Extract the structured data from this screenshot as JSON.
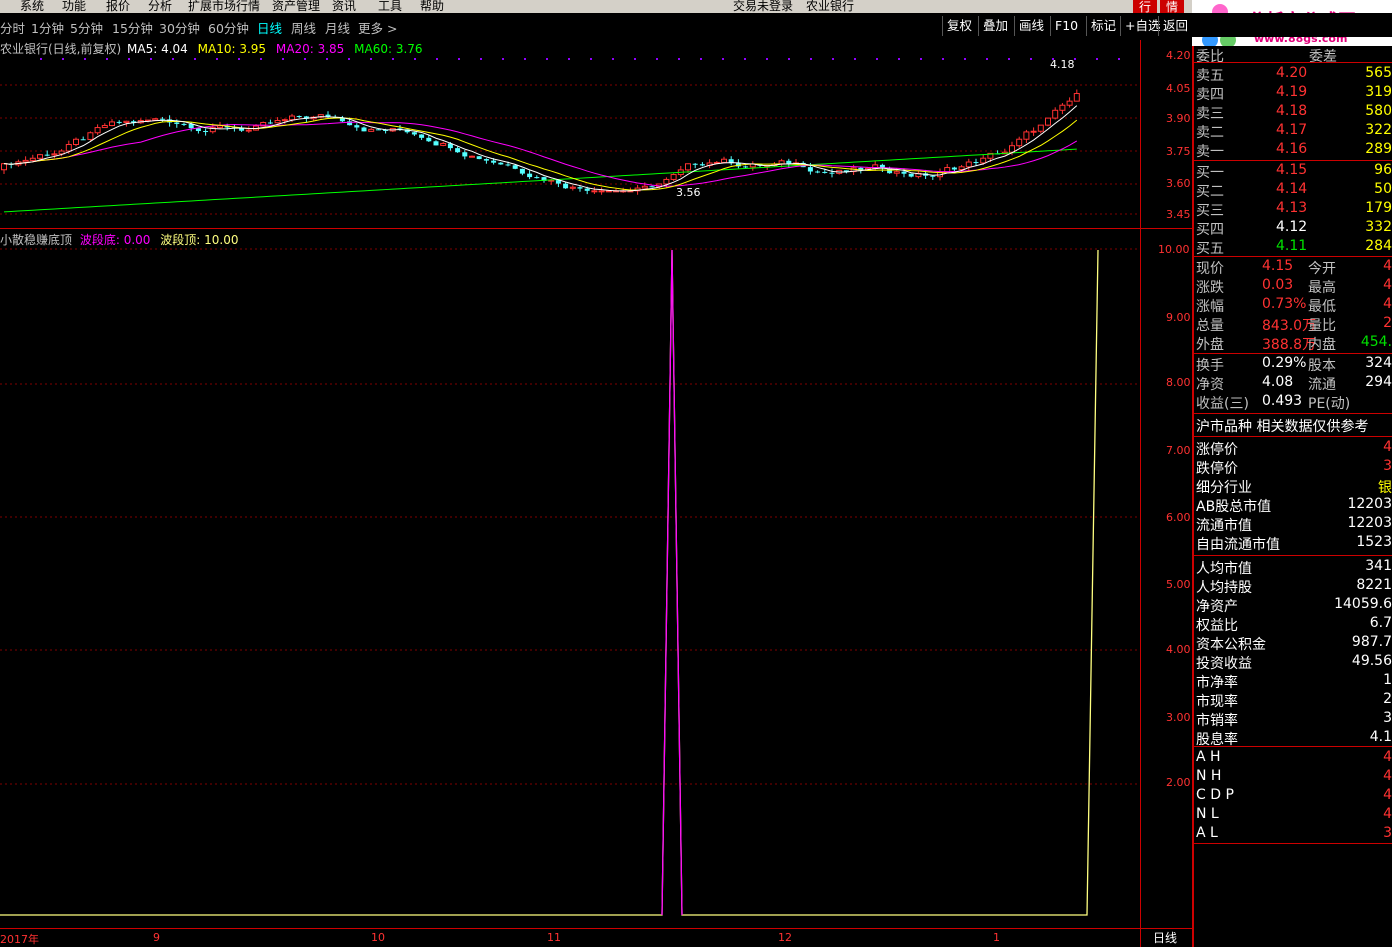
{
  "menubar": {
    "items": [
      "系统",
      "功能",
      "报价",
      "分析",
      "扩展市场行情",
      "资产管理",
      "资讯",
      "工具",
      "帮助"
    ],
    "center_status": "交易未登录",
    "stock_name": "农业银行",
    "tabs": [
      "行",
      "情"
    ]
  },
  "logo": {
    "main_text": "分析家公式网",
    "sub_text": "www.88gs.com"
  },
  "toolbar": {
    "periods": [
      "分时",
      "1分钟",
      "5分钟",
      "15分钟",
      "30分钟",
      "60分钟",
      "日线",
      "周线",
      "月线",
      "更多 >"
    ],
    "active_period": "日线",
    "buttons": [
      "复权",
      "叠加",
      "画线",
      "F10",
      "标记",
      "+自选",
      "返回"
    ]
  },
  "main_chart": {
    "title": "农业银行(日线,前复权)",
    "ma": [
      {
        "label": "MA5: 4.04",
        "color": "#ffffff"
      },
      {
        "label": "MA10: 3.95",
        "color": "#ffff00"
      },
      {
        "label": "MA20: 3.85",
        "color": "#ff00ff"
      },
      {
        "label": "MA60: 3.76",
        "color": "#00ff00"
      }
    ],
    "y_ticks": [
      "4.20",
      "4.05",
      "3.90",
      "3.75",
      "3.60",
      "3.45"
    ],
    "high_label": "4.18",
    "low_label": "3.56"
  },
  "indicator": {
    "name": "小散稳赚底顶",
    "low_label": "波段底: 0.00",
    "high_label": "波段顶: 10.00",
    "low_color": "#ff00ff",
    "high_color": "#ffff00",
    "y_ticks": [
      "10.00",
      "9.00",
      "8.00",
      "7.00",
      "6.00",
      "5.00",
      "4.00",
      "3.00",
      "2.00"
    ]
  },
  "x_axis": {
    "labels": [
      "2017年",
      "9",
      "10",
      "11",
      "12",
      "1"
    ],
    "period_label": "日线"
  },
  "quote": {
    "header_left": "委比",
    "header_right": "委差",
    "asks": [
      {
        "label": "卖五",
        "price": "4.20",
        "vol": "565"
      },
      {
        "label": "卖四",
        "price": "4.19",
        "vol": "319"
      },
      {
        "label": "卖三",
        "price": "4.18",
        "vol": "580"
      },
      {
        "label": "卖二",
        "price": "4.17",
        "vol": "322"
      },
      {
        "label": "卖一",
        "price": "4.16",
        "vol": "289"
      }
    ],
    "bids": [
      {
        "label": "买一",
        "price": "4.15",
        "vol": "96"
      },
      {
        "label": "买二",
        "price": "4.14",
        "vol": "50"
      },
      {
        "label": "买三",
        "price": "4.13",
        "vol": "179"
      },
      {
        "label": "买四",
        "price": "4.12",
        "vol": "332"
      },
      {
        "label": "买五",
        "price": "4.11",
        "vol": "284"
      }
    ],
    "stats1": [
      {
        "l": "现价",
        "v": "4.15",
        "l2": "今开",
        "v2": "4"
      },
      {
        "l": "涨跌",
        "v": "0.03",
        "l2": "最高",
        "v2": "4"
      },
      {
        "l": "涨幅",
        "v": "0.73%",
        "l2": "最低",
        "v2": "4"
      },
      {
        "l": "总量",
        "v": "843.0万",
        "l2": "量比",
        "v2": "2"
      },
      {
        "l": "外盘",
        "v": "388.8万",
        "l2": "内盘",
        "v2": "454."
      }
    ],
    "stats2": [
      {
        "l": "换手",
        "v": "0.29%",
        "l2": "股本",
        "v2": "324"
      },
      {
        "l": "净资",
        "v": "4.08",
        "l2": "流通",
        "v2": "294"
      },
      {
        "l": "收益(三)",
        "v": "0.493",
        "l2": "PE(动)",
        "v2": ""
      }
    ],
    "market_title": "沪市品种  相关数据仅供参考",
    "info1": [
      {
        "l": "涨停价",
        "v": "4"
      },
      {
        "l": "跌停价",
        "v": "3"
      },
      {
        "l": "细分行业",
        "v": "银"
      },
      {
        "l": "AB股总市值",
        "v": "12203"
      },
      {
        "l": "流通市值",
        "v": "12203"
      },
      {
        "l": "自由流通市值",
        "v": "1523"
      }
    ],
    "info2": [
      {
        "l": "人均市值",
        "v": "341"
      },
      {
        "l": "人均持股",
        "v": "8221"
      },
      {
        "l": "净资产",
        "v": "14059.6"
      },
      {
        "l": "权益比",
        "v": "6.7"
      },
      {
        "l": "资本公积金",
        "v": "987.7"
      },
      {
        "l": "投资收益",
        "v": "49.56"
      },
      {
        "l": "市净率",
        "v": "1"
      },
      {
        "l": "市现率",
        "v": "2"
      },
      {
        "l": "市销率",
        "v": "3"
      },
      {
        "l": "股息率",
        "v": "4.1"
      }
    ],
    "info3": [
      {
        "l": "A H",
        "v": "4"
      },
      {
        "l": "N H",
        "v": "4"
      },
      {
        "l": "C D P",
        "v": "4"
      },
      {
        "l": "N L",
        "v": "4"
      },
      {
        "l": "A L",
        "v": "3"
      }
    ]
  }
}
